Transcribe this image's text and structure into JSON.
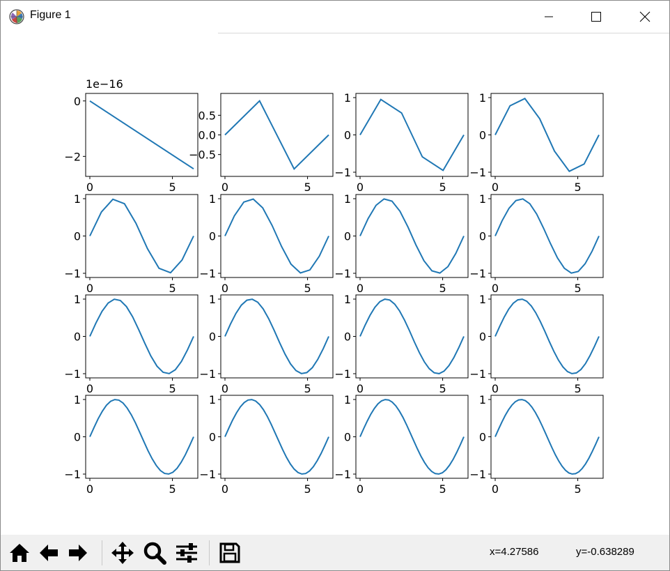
{
  "window": {
    "title": "Figure 1",
    "icon": "matplotlib-logo-icon",
    "controls": [
      "minimize-icon",
      "maximize-icon",
      "close-icon"
    ]
  },
  "figure": {
    "offset_label": "1e−16"
  },
  "chart_data": [
    {
      "type": "line",
      "panel": "r1c1",
      "n_points": 2,
      "x": [
        0,
        6.283
      ],
      "y": [
        0,
        -2.449e-16
      ],
      "xlim": [
        0,
        6.283
      ],
      "ylim": [
        -2.57e-16,
        1.2e-17
      ],
      "y_ticks": [
        "0",
        "−2"
      ],
      "x_ticks": [
        "0",
        "5"
      ],
      "y_scale_label": "1e−16"
    },
    {
      "type": "line",
      "panel": "r1c2",
      "n_points": 4,
      "x": [
        0,
        2.094,
        4.189,
        6.283
      ],
      "y": [
        0,
        0.866,
        -0.866,
        0
      ],
      "xlim": [
        0,
        6.283
      ],
      "ylim": [
        -0.95,
        0.95
      ],
      "y_ticks": [
        "0.5",
        "0.0",
        "−0.5"
      ],
      "x_ticks": [
        "0",
        "5"
      ]
    },
    {
      "type": "line",
      "panel": "r1c3",
      "n_points": 6,
      "x": [
        0,
        1.257,
        2.513,
        3.77,
        5.027,
        6.283
      ],
      "y": [
        0,
        0.951,
        0.588,
        -0.588,
        -0.951,
        0
      ],
      "xlim": [
        0,
        6.283
      ],
      "ylim": [
        -1,
        1
      ],
      "y_ticks": [
        "1",
        "0",
        "−1"
      ],
      "x_ticks": [
        "0",
        "5"
      ]
    },
    {
      "type": "line",
      "panel": "r1c4",
      "n_points": 8,
      "x": [
        0,
        0.898,
        1.795,
        2.693,
        3.59,
        4.488,
        5.386,
        6.283
      ],
      "y": [
        0,
        0.782,
        0.975,
        0.434,
        -0.434,
        -0.975,
        -0.782,
        0
      ],
      "xlim": [
        0,
        6.283
      ],
      "ylim": [
        -1,
        1
      ],
      "y_ticks": [
        "1",
        "0",
        "−1"
      ],
      "x_ticks": [
        "0",
        "5"
      ]
    },
    {
      "type": "line",
      "panel": "r2c1",
      "n_points": 10,
      "function": "sin(x)",
      "xlim": [
        0,
        6.283
      ],
      "ylim": [
        -1,
        1
      ],
      "y_ticks": [
        "1",
        "0",
        "−1"
      ],
      "x_ticks": [
        "0",
        "5"
      ]
    },
    {
      "type": "line",
      "panel": "r2c2",
      "n_points": 12,
      "function": "sin(x)",
      "xlim": [
        0,
        6.283
      ],
      "ylim": [
        -1,
        1
      ],
      "y_ticks": [
        "1",
        "0",
        "−1"
      ],
      "x_ticks": [
        "0",
        "5"
      ]
    },
    {
      "type": "line",
      "panel": "r2c3",
      "n_points": 14,
      "function": "sin(x)",
      "xlim": [
        0,
        6.283
      ],
      "ylim": [
        -1,
        1
      ],
      "y_ticks": [
        "1",
        "0",
        "−1"
      ],
      "x_ticks": [
        "0",
        "5"
      ]
    },
    {
      "type": "line",
      "panel": "r2c4",
      "n_points": 16,
      "function": "sin(x)",
      "xlim": [
        0,
        6.283
      ],
      "ylim": [
        -1,
        1
      ],
      "y_ticks": [
        "1",
        "0",
        "−1"
      ],
      "x_ticks": [
        "0",
        "5"
      ]
    },
    {
      "type": "line",
      "panel": "r3c1",
      "n_points": 18,
      "function": "sin(x)",
      "xlim": [
        0,
        6.283
      ],
      "ylim": [
        -1,
        1
      ],
      "y_ticks": [
        "1",
        "0",
        "−1"
      ],
      "x_ticks": [
        "0",
        "5"
      ]
    },
    {
      "type": "line",
      "panel": "r3c2",
      "n_points": 20,
      "function": "sin(x)",
      "xlim": [
        0,
        6.283
      ],
      "ylim": [
        -1,
        1
      ],
      "y_ticks": [
        "1",
        "0",
        "−1"
      ],
      "x_ticks": [
        "0",
        "5"
      ]
    },
    {
      "type": "line",
      "panel": "r3c3",
      "n_points": 22,
      "function": "sin(x)",
      "xlim": [
        0,
        6.283
      ],
      "ylim": [
        -1,
        1
      ],
      "y_ticks": [
        "1",
        "0",
        "−1"
      ],
      "x_ticks": [
        "0",
        "5"
      ]
    },
    {
      "type": "line",
      "panel": "r3c4",
      "n_points": 24,
      "function": "sin(x)",
      "xlim": [
        0,
        6.283
      ],
      "ylim": [
        -1,
        1
      ],
      "y_ticks": [
        "1",
        "0",
        "−1"
      ],
      "x_ticks": [
        "0",
        "5"
      ]
    },
    {
      "type": "line",
      "panel": "r4c1",
      "n_points": 26,
      "function": "sin(x)",
      "xlim": [
        0,
        6.283
      ],
      "ylim": [
        -1,
        1
      ],
      "y_ticks": [
        "1",
        "0",
        "−1"
      ],
      "x_ticks": [
        "0",
        "5"
      ]
    },
    {
      "type": "line",
      "panel": "r4c2",
      "n_points": 28,
      "function": "sin(x)",
      "xlim": [
        0,
        6.283
      ],
      "ylim": [
        -1,
        1
      ],
      "y_ticks": [
        "1",
        "0",
        "−1"
      ],
      "x_ticks": [
        "0",
        "5"
      ]
    },
    {
      "type": "line",
      "panel": "r4c3",
      "n_points": 30,
      "function": "sin(x)",
      "xlim": [
        0,
        6.283
      ],
      "ylim": [
        -1,
        1
      ],
      "y_ticks": [
        "1",
        "0",
        "−1"
      ],
      "x_ticks": [
        "0",
        "5"
      ]
    },
    {
      "type": "line",
      "panel": "r4c4",
      "n_points": 32,
      "function": "sin(x)",
      "xlim": [
        0,
        6.283
      ],
      "ylim": [
        -1,
        1
      ],
      "y_ticks": [
        "1",
        "0",
        "−1"
      ],
      "x_ticks": [
        "0",
        "5"
      ]
    }
  ],
  "colors": {
    "line": "#1f77b4",
    "toolbar_bg": "#f0f0f0"
  },
  "toolbar": {
    "buttons": [
      {
        "name": "home-button",
        "icon": "home-icon"
      },
      {
        "name": "back-button",
        "icon": "arrow-left-icon"
      },
      {
        "name": "forward-button",
        "icon": "arrow-right-icon"
      },
      {
        "name": "pan-button",
        "icon": "move-icon"
      },
      {
        "name": "zoom-button",
        "icon": "magnifier-icon"
      },
      {
        "name": "configure-subplots-button",
        "icon": "sliders-icon"
      },
      {
        "name": "save-button",
        "icon": "floppy-disk-icon"
      }
    ],
    "coord_x": "x=4.27586",
    "coord_y": "y=-0.638289"
  }
}
